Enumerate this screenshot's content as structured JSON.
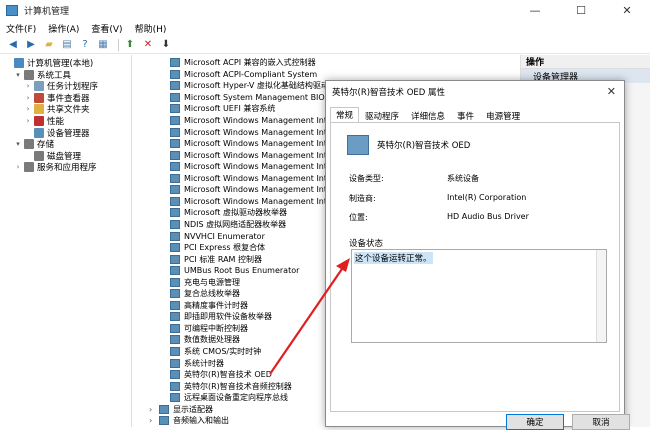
{
  "window": {
    "title": "计算机管理",
    "controls": [
      "—",
      "☐",
      "✕"
    ]
  },
  "menu": [
    "文件(F)",
    "操作(A)",
    "查看(V)",
    "帮助(H)"
  ],
  "toolbar": {
    "icons": [
      "back-icon",
      "forward-icon",
      "folder-up-icon",
      "properties-icon",
      "help-icon",
      "show-hide-icon",
      "scan-icon",
      "uninstall-icon",
      "update-icon"
    ]
  },
  "left_tree": [
    {
      "label": "计算机管理(本地)",
      "level": 0,
      "arrow": "",
      "color": "#4a8ac0"
    },
    {
      "label": "系统工具",
      "level": 1,
      "arrow": "▾",
      "color": "#7a7a7a"
    },
    {
      "label": "任务计划程序",
      "level": 2,
      "arrow": "›",
      "color": "#7aa0c0"
    },
    {
      "label": "事件查看器",
      "level": 2,
      "arrow": "›",
      "color": "#c04a3a"
    },
    {
      "label": "共享文件夹",
      "level": 2,
      "arrow": "›",
      "color": "#e0b040"
    },
    {
      "label": "性能",
      "level": 2,
      "arrow": "›",
      "color": "#c03030"
    },
    {
      "label": "设备管理器",
      "level": 2,
      "arrow": "",
      "color": "#5a8fb8"
    },
    {
      "label": "存储",
      "level": 1,
      "arrow": "▾",
      "color": "#7a7a7a"
    },
    {
      "label": "磁盘管理",
      "level": 2,
      "arrow": "",
      "color": "#7a7a7a"
    },
    {
      "label": "服务和应用程序",
      "level": 1,
      "arrow": "›",
      "color": "#7a7a7a"
    }
  ],
  "devices": [
    "Microsoft ACPI 兼容的嵌入式控制器",
    "Microsoft ACPI-Compliant System",
    "Microsoft Hyper-V 虚拟化基础结构驱动",
    "Microsoft System Management BIOS D",
    "Microsoft UEFI 兼容系统",
    "Microsoft Windows Management Interfa",
    "Microsoft Windows Management Interfa",
    "Microsoft Windows Management Interfa",
    "Microsoft Windows Management Interfa",
    "Microsoft Windows Management Interfa",
    "Microsoft Windows Management Interfa",
    "Microsoft Windows Management Interfa",
    "Microsoft Windows Management Interfa",
    "Microsoft 虚拟驱动器枚举器",
    "NDIS 虚拟网络适配器枚举器",
    "NVVHCI Enumerator",
    "PCI Express 根复合体",
    "PCI 标准 RAM 控制器",
    "UMBus Root Bus Enumerator",
    "充电与电源管理",
    "复合总线枚举器",
    "高精度事件计时器",
    "即插即用软件设备枚举器",
    "可编程中断控制器",
    "数值数据处理器",
    "系统 CMOS/实时时钟",
    "系统计时器",
    "英特尔(R)智音技术 OED",
    "英特尔(R)智音技术音频控制器",
    "远程桌面设备重定向程序总线"
  ],
  "device_groups": [
    "显示适配器",
    "音频输入和输出"
  ],
  "actions": {
    "header": "操作",
    "sub": "设备管理器"
  },
  "dialog": {
    "title": "英特尔(R)智音技术 OED 属性",
    "close": "✕",
    "tabs": [
      "常规",
      "驱动程序",
      "详细信息",
      "事件",
      "电源管理"
    ],
    "device_name": "英特尔(R)智音技术 OED",
    "props": [
      {
        "label": "设备类型:",
        "value": "系统设备"
      },
      {
        "label": "制造商:",
        "value": "Intel(R) Corporation"
      },
      {
        "label": "位置:",
        "value": "HD Audio Bus Driver"
      }
    ],
    "status_label": "设备状态",
    "status_text": "这个设备运转正常。",
    "ok": "确定",
    "cancel": "取消"
  },
  "annotation_color": "#e02020"
}
